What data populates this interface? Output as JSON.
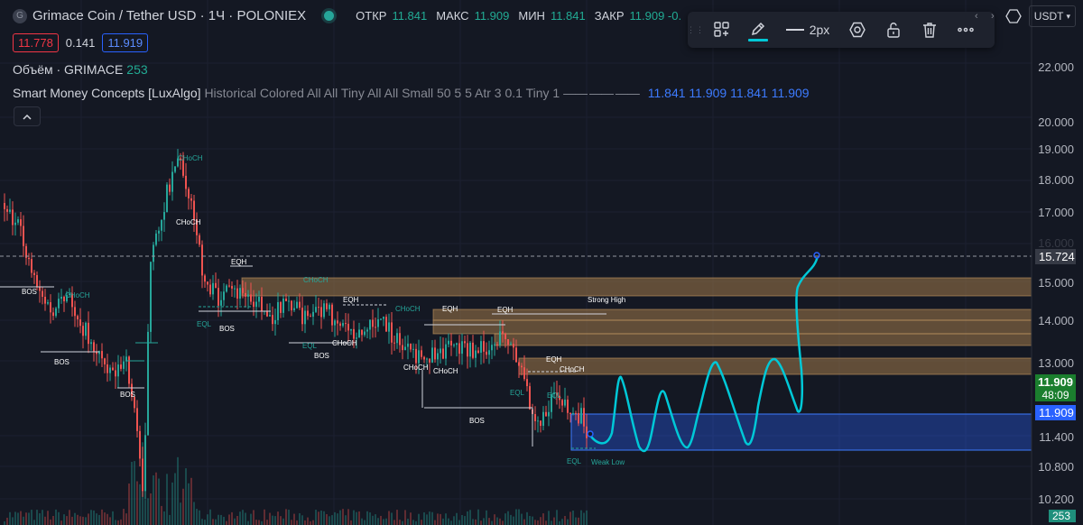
{
  "header": {
    "logo_letter": "G",
    "title": "Grimace Coin / Tether USD · 1Ч · POLONIEX",
    "open_label": "ОТКР",
    "open_value": "11.841",
    "high_label": "МАКС",
    "high_value": "11.909",
    "low_label": "МИН",
    "low_value": "11.841",
    "close_label": "ЗАКР",
    "close_value": "11.909 -0.",
    "sell_price": "11.778",
    "spread": "0.141",
    "buy_price": "11.919"
  },
  "indicators": {
    "volume_label": "Объём · GRIMACE",
    "volume_value": "253",
    "smc_name": "Smart Money Concepts [LuxAlgo]",
    "smc_params": "Historical Colored All All Tiny All All Small 50 5 5 Atr 3 0.1 Tiny 1",
    "smc_values": [
      "11.841",
      "11.909",
      "11.841",
      "11.909"
    ]
  },
  "toolbar": {
    "width_label": "2px"
  },
  "currency": "USDT",
  "axis": {
    "labels": [
      "22.000",
      "20.000",
      "19.000",
      "18.000",
      "17.000",
      "15.000",
      "14.000",
      "13.000",
      "11.400",
      "10.800",
      "10.200"
    ],
    "crosshair_price": "15.724",
    "current_price": "11.909",
    "countdown": "48:09",
    "blue_price": "11.909",
    "volume_tag": "253"
  },
  "annotations": {
    "labels": [
      "BOS",
      "BOS",
      "BOS",
      "BOS",
      "BOS",
      "BOS",
      "EQH",
      "EQH",
      "EQH",
      "EQH",
      "EQH",
      "EQL",
      "EQL",
      "EQL",
      "EQL",
      "EQL",
      "CHoCH",
      "CHoCH",
      "CHoCH",
      "CHoCH",
      "CHoCH",
      "CHoCH",
      "CHoCH",
      "CHoCH",
      "CHoCH",
      "Strong High",
      "Weak Low"
    ]
  },
  "colors": {
    "background": "#141823",
    "up": "#26a69a",
    "down": "#ef5350",
    "bearish_zone": "#a07a4a",
    "demand_zone": "#2962ff",
    "drawing": "#00c8d7"
  }
}
